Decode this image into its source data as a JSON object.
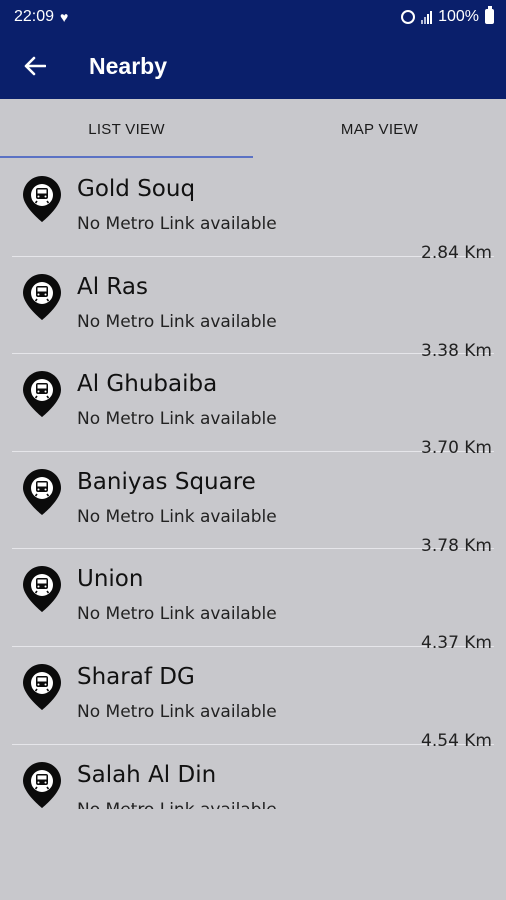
{
  "status": {
    "time": "22:09",
    "battery": "100%"
  },
  "header": {
    "title": "Nearby",
    "back_icon": "arrow-left-icon"
  },
  "tabs": [
    {
      "label": "LIST VIEW",
      "active": true
    },
    {
      "label": "MAP VIEW",
      "active": false
    }
  ],
  "colors": {
    "appbar": "#0a1f6b",
    "background": "#c8c8cc",
    "tab_indicator": "#5b72c4"
  },
  "stations": [
    {
      "name": "Gold Souq",
      "subtitle": "No Metro Link available",
      "distance": "2.84 Km"
    },
    {
      "name": "Al Ras",
      "subtitle": "No Metro Link available",
      "distance": "3.38 Km"
    },
    {
      "name": "Al Ghubaiba",
      "subtitle": "No Metro Link available",
      "distance": "3.70 Km"
    },
    {
      "name": "Baniyas Square",
      "subtitle": "No Metro Link available",
      "distance": "3.78 Km"
    },
    {
      "name": "Union",
      "subtitle": "No Metro Link available",
      "distance": "4.37 Km"
    },
    {
      "name": "Sharaf DG",
      "subtitle": "No Metro Link available",
      "distance": "4.54 Km"
    },
    {
      "name": "Salah Al Din",
      "subtitle": "No Metro Link available",
      "distance": ""
    }
  ]
}
